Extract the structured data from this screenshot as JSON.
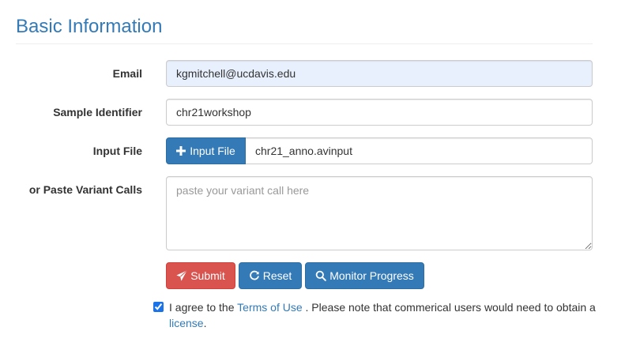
{
  "section": {
    "title": "Basic Information"
  },
  "form": {
    "email": {
      "label": "Email",
      "value": "kgmitchell@ucdavis.edu"
    },
    "sample": {
      "label": "Sample Identifier",
      "value": "chr21workshop"
    },
    "input_file": {
      "label": "Input File",
      "button_label": "Input File",
      "file_name": "chr21_anno.avinput"
    },
    "paste": {
      "label": "or Paste Variant Calls",
      "placeholder": "paste your variant call here"
    }
  },
  "buttons": {
    "submit": "Submit",
    "reset": "Reset",
    "monitor": "Monitor Progress"
  },
  "agreement": {
    "checked": true,
    "prefix": "I agree to the",
    "terms_link": "Terms of Use",
    "middle": ". Please note that commerical users would need to obtain a",
    "license_link": "license",
    "suffix": "."
  },
  "colors": {
    "heading": "#337ab7",
    "primary": "#337ab7",
    "danger": "#d9534f",
    "autofill": "#e8f0fe"
  },
  "icons": {
    "input_file": "plus-icon",
    "submit": "paper-plane-icon",
    "reset": "refresh-icon",
    "monitor": "search-icon"
  }
}
